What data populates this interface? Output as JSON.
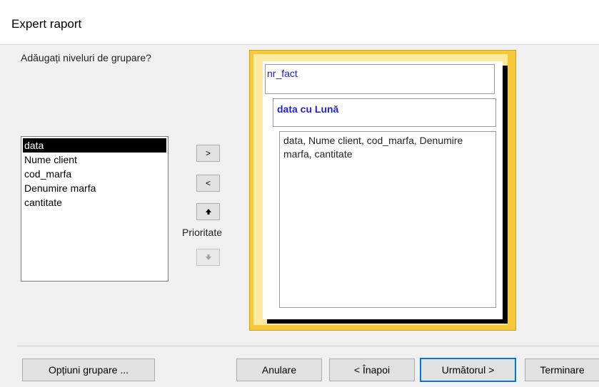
{
  "window": {
    "title": "Expert raport"
  },
  "prompt": "Adăugați niveluri de grupare?",
  "fields": [
    "data",
    "Nume client",
    "cod_marfa",
    "Denumire marfa",
    "cantitate"
  ],
  "selected_field_index": 0,
  "side_buttons": {
    "add": ">",
    "remove": "<",
    "priority_label": "Prioritate"
  },
  "preview": {
    "level1": "nr_fact",
    "level2": "data cu Lună",
    "detail": "data, Nume client, cod_marfa, Denumire marfa, cantitate",
    "frame_color": "#f6c93a",
    "group_text_color": "#1f1fd0"
  },
  "buttons": {
    "options": "Opțiuni grupare ...",
    "cancel": "Anulare",
    "back": "< Înapoi",
    "next": "Următorul >",
    "finish": "Terminare"
  }
}
